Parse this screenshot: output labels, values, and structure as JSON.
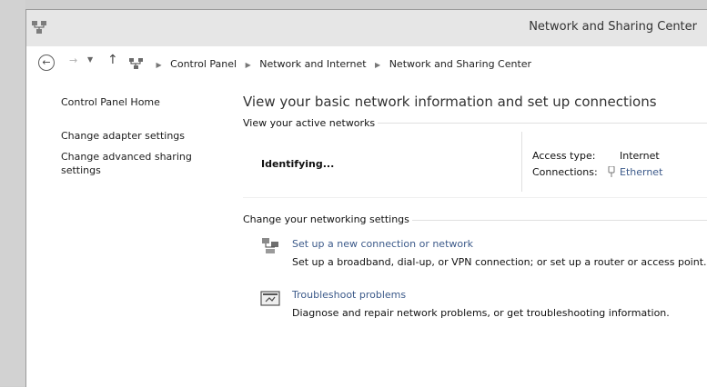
{
  "window": {
    "title": "Network and Sharing Center"
  },
  "address": {
    "crumbs": [
      "Control Panel",
      "Network and Internet",
      "Network and Sharing Center"
    ]
  },
  "sidebar": {
    "items": [
      {
        "label": "Control Panel Home"
      },
      {
        "label": "Change adapter settings"
      },
      {
        "label": "Change advanced sharing settings"
      }
    ]
  },
  "main": {
    "title": "View your basic network information and set up connections",
    "active_networks_header": "View your active networks",
    "network_name": "Identifying...",
    "access_type_label": "Access type:",
    "access_type_value": "Internet",
    "connections_label": "Connections:",
    "connections_value": "Ethernet",
    "change_settings_header": "Change your networking settings",
    "tasks": [
      {
        "title": "Set up a new connection or network",
        "desc": "Set up a broadband, dial-up, or VPN connection; or set up a router or access point.",
        "icon": "network-setup-icon"
      },
      {
        "title": "Troubleshoot problems",
        "desc": "Diagnose and repair network problems, or get troubleshooting information.",
        "icon": "troubleshoot-icon"
      }
    ]
  }
}
